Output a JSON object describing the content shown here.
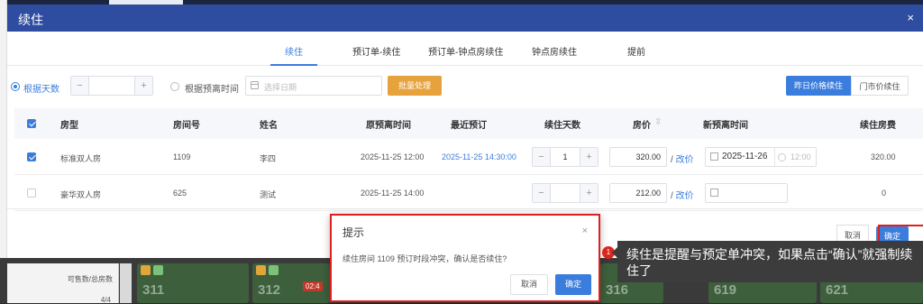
{
  "dialog": {
    "title": "续住",
    "close": "×"
  },
  "tabs": [
    {
      "label": "续住"
    },
    {
      "label": "预订单-续住"
    },
    {
      "label": "预订单-钟点房续住"
    },
    {
      "label": "钟点房续住"
    },
    {
      "label": "提前"
    }
  ],
  "filters": {
    "by_days_label": "根据天数",
    "by_days_minus": "−",
    "by_days_plus": "+",
    "by_date_label": "根据预离时间",
    "date_placeholder": "选择日期",
    "batch_button": "批量处理",
    "price_mode_yesterday": "昨日价格续住",
    "price_mode_market": "门市价续住"
  },
  "table": {
    "headers": [
      "房型",
      "房间号",
      "姓名",
      "原预离时间",
      "最近预订",
      "续住天数",
      "房价",
      "新预离时间",
      "续住房费"
    ],
    "sort_icon": "⇳",
    "rows": [
      {
        "room_type": "标准双人房",
        "room_no": "1109",
        "name": "李四",
        "orig_departure": "2025-11-25 12:00",
        "recent_booking": "2025-11-25 14:30:00",
        "days": "1",
        "price": "320.00",
        "change_price": "改价",
        "new_date": "2025-11-26",
        "new_time": "12:00",
        "fee": "320.00",
        "checked": true
      },
      {
        "room_type": "豪华双人房",
        "room_no": "625",
        "name": "测试",
        "orig_departure": "2025-11-25 14:00",
        "recent_booking": "",
        "days": "",
        "price": "212.00",
        "change_price": "改价",
        "new_date": "",
        "new_time": "",
        "fee": "0",
        "checked": false
      }
    ]
  },
  "footer": {
    "cancel": "取消",
    "ok": "确定"
  },
  "confirm": {
    "title": "提示",
    "close": "×",
    "message": "续住房间 1109 预订时段冲突，确认是否续住?",
    "cancel": "取消",
    "ok": "确定"
  },
  "annotation": {
    "number": "1",
    "text": "续住是提醒与预定单冲突，如果点击“确认”就强制续住了"
  },
  "background": {
    "stats_label": "可售数/总房数",
    "stats_value": "4/4",
    "rooms": [
      {
        "num": "311",
        "color": "#3d5f3c"
      },
      {
        "num": "312",
        "color": "#3d5f3c",
        "badge": "02:4"
      },
      {
        "num": "316",
        "color": "#3d5f3c"
      },
      {
        "num": "619",
        "color": "#3d5f3c"
      },
      {
        "num": "621",
        "color": "#3d5f3c"
      }
    ]
  },
  "colors": {
    "header": "#2f4da0",
    "accent": "#3b7ddd",
    "batch": "#e6a23c",
    "highlight": "#e02020"
  }
}
